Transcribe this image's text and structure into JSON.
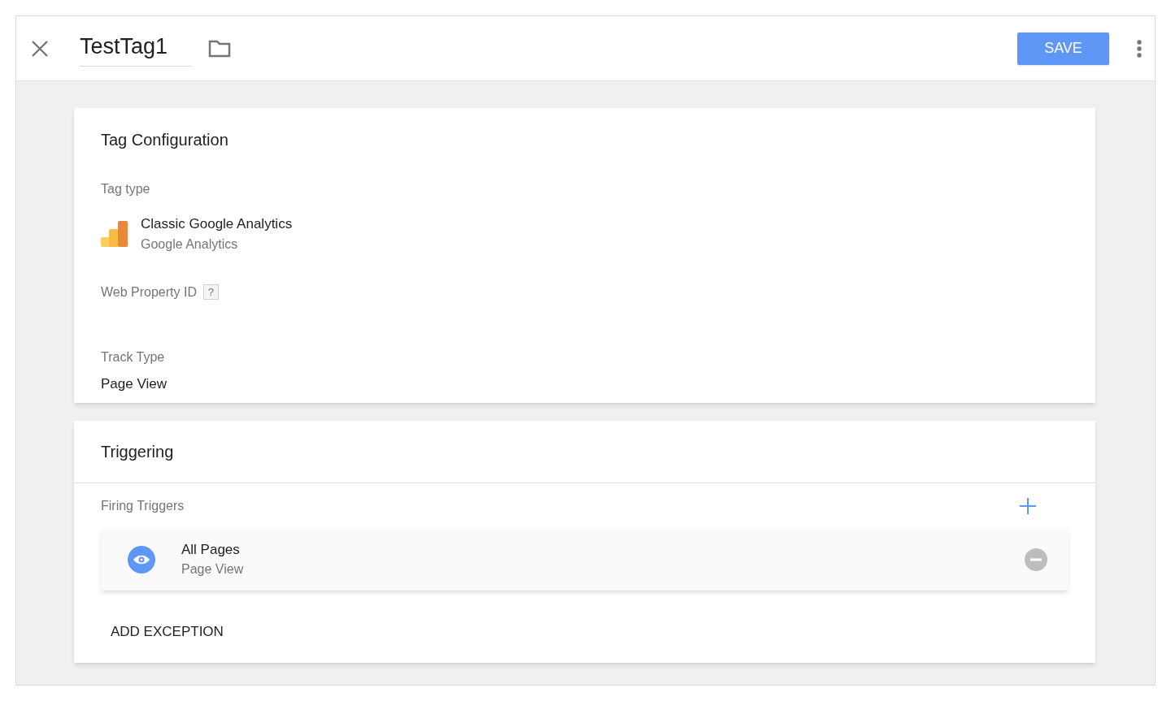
{
  "header": {
    "tag_name": "TestTag1",
    "save_label": "SAVE"
  },
  "tag_configuration": {
    "title": "Tag Configuration",
    "tag_type_label": "Tag type",
    "tag_type": {
      "name": "Classic Google Analytics",
      "vendor": "Google Analytics"
    },
    "web_property_label": "Web Property ID",
    "help_mark": "?",
    "track_type_label": "Track Type",
    "track_type": "Page View"
  },
  "triggering": {
    "title": "Triggering",
    "firing_label": "Firing Triggers",
    "triggers": [
      {
        "name": "All Pages",
        "type": "Page View"
      }
    ],
    "add_exception": "ADD EXCEPTION"
  }
}
